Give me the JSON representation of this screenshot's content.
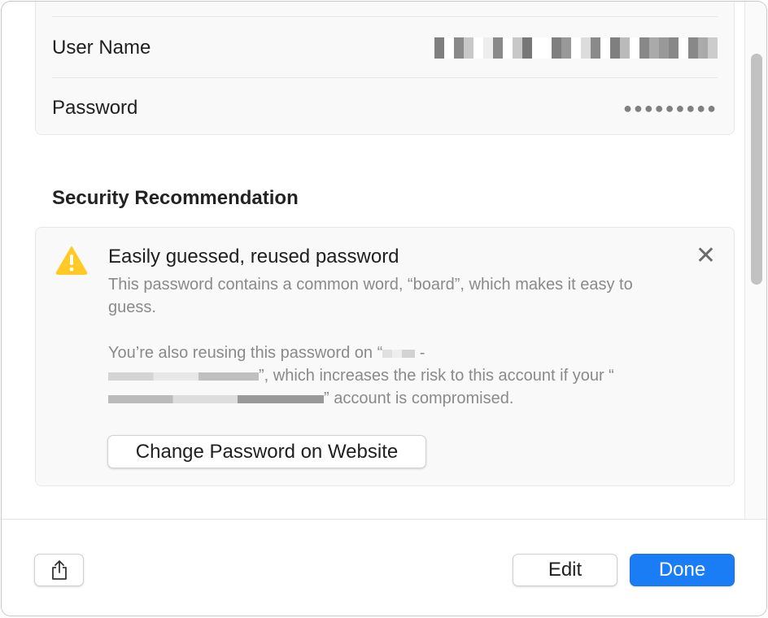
{
  "account": {
    "top_separator": true,
    "fields": [
      {
        "label": "User Name",
        "value_redacted": true
      },
      {
        "label": "Password",
        "value": "●●●●●●●●●"
      }
    ]
  },
  "security": {
    "heading": "Security Recommendation",
    "warning_icon": "warning-triangle-icon",
    "warning_color": "#FFC926",
    "title": "Easily guessed, reused password",
    "paragraph1": "This password contains a common word, “board”, which makes it easy to guess.",
    "p2_prefix": "You’re also reusing this password on “",
    "p2_dash": " - ",
    "p2_middle": "”, which increases the risk to this account if your “",
    "p2_suffix": "” account is compromised.",
    "close_icon": "close-icon",
    "change_button": "Change Password on Website"
  },
  "footer": {
    "share_icon": "share-icon",
    "edit": "Edit",
    "done": "Done",
    "accent": "#1A7DF5"
  }
}
